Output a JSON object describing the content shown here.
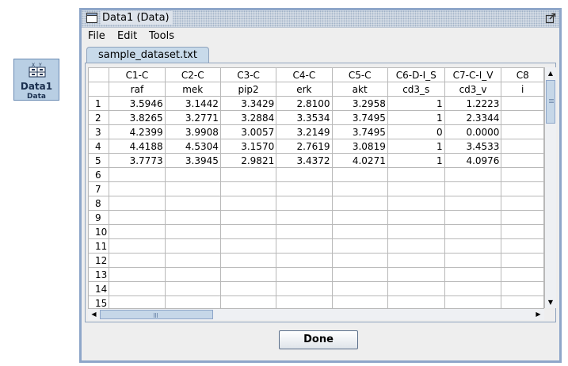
{
  "node": {
    "title": "Data1",
    "subtitle": "Data"
  },
  "window": {
    "title": "Data1 (Data)"
  },
  "menu": [
    "File",
    "Edit",
    "Tools"
  ],
  "tab": {
    "label": "sample_dataset.txt"
  },
  "grid": {
    "columns": [
      {
        "header": "C1-C",
        "name": "raf"
      },
      {
        "header": "C2-C",
        "name": "mek"
      },
      {
        "header": "C3-C",
        "name": "pip2"
      },
      {
        "header": "C4-C",
        "name": "erk"
      },
      {
        "header": "C5-C",
        "name": "akt"
      },
      {
        "header": "C6-D-I_S",
        "name": "cd3_s"
      },
      {
        "header": "C7-C-I_V",
        "name": "cd3_v"
      },
      {
        "header": "C8",
        "name": "i"
      }
    ],
    "rows": [
      {
        "label": "1",
        "cells": [
          "3.5946",
          "3.1442",
          "3.3429",
          "2.8100",
          "3.2958",
          "1",
          "1.2223",
          ""
        ]
      },
      {
        "label": "2",
        "cells": [
          "3.8265",
          "3.2771",
          "3.2884",
          "3.3534",
          "3.7495",
          "1",
          "2.3344",
          ""
        ]
      },
      {
        "label": "3",
        "cells": [
          "4.2399",
          "3.9908",
          "3.0057",
          "3.2149",
          "3.7495",
          "0",
          "0.0000",
          ""
        ]
      },
      {
        "label": "4",
        "cells": [
          "4.4188",
          "4.5304",
          "3.1570",
          "2.7619",
          "3.0819",
          "1",
          "3.4533",
          ""
        ]
      },
      {
        "label": "5",
        "cells": [
          "3.7773",
          "3.3945",
          "2.9821",
          "3.4372",
          "4.0271",
          "1",
          "4.0976",
          ""
        ]
      },
      {
        "label": "6",
        "cells": [
          "",
          "",
          "",
          "",
          "",
          "",
          "",
          ""
        ]
      },
      {
        "label": "7",
        "cells": [
          "",
          "",
          "",
          "",
          "",
          "",
          "",
          ""
        ]
      },
      {
        "label": "8",
        "cells": [
          "",
          "",
          "",
          "",
          "",
          "",
          "",
          ""
        ]
      },
      {
        "label": "9",
        "cells": [
          "",
          "",
          "",
          "",
          "",
          "",
          "",
          ""
        ]
      },
      {
        "label": "10",
        "cells": [
          "",
          "",
          "",
          "",
          "",
          "",
          "",
          ""
        ]
      },
      {
        "label": "11",
        "cells": [
          "",
          "",
          "",
          "",
          "",
          "",
          "",
          ""
        ]
      },
      {
        "label": "12",
        "cells": [
          "",
          "",
          "",
          "",
          "",
          "",
          "",
          ""
        ]
      },
      {
        "label": "13",
        "cells": [
          "",
          "",
          "",
          "",
          "",
          "",
          "",
          ""
        ]
      },
      {
        "label": "14",
        "cells": [
          "",
          "",
          "",
          "",
          "",
          "",
          "",
          ""
        ]
      },
      {
        "label": "15",
        "cells": [
          "",
          "",
          "",
          "",
          "",
          "",
          "",
          ""
        ]
      }
    ]
  },
  "buttons": {
    "done": "Done"
  },
  "icons": {
    "node": "data-grid-icon",
    "window": "window-icon",
    "maximize": "maximize-icon",
    "scroll_up": "arrow-up-icon",
    "scroll_down": "arrow-down-icon",
    "scroll_left": "arrow-left-icon",
    "scroll_right": "arrow-right-icon"
  },
  "colors": {
    "node_fill": "#b9cfe4",
    "frame_border": "#8ea6c9",
    "tab_fill": "#c8daea",
    "grid_line": "#b8b8b8"
  }
}
